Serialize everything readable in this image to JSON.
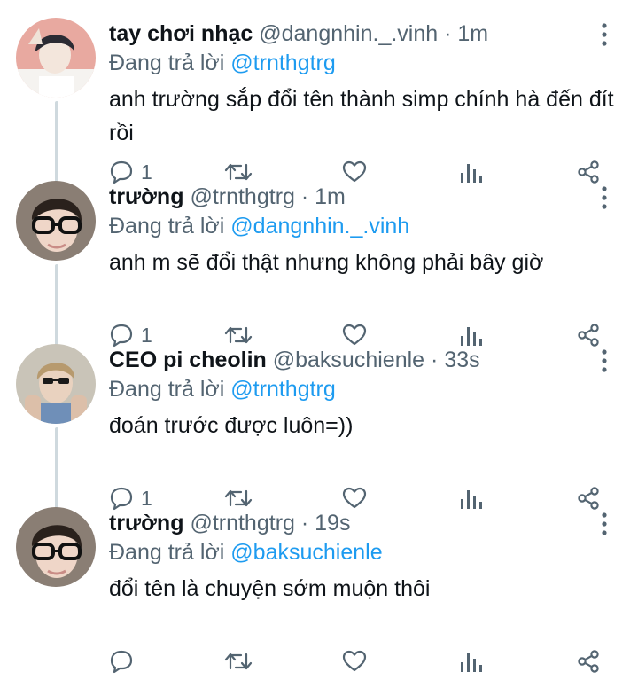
{
  "tweets": [
    {
      "display_name": "tay chơi nhạc",
      "handle": "@dangnhin._.vinh",
      "separator": "·",
      "time": "1m",
      "replying_prefix": "Đang trả lời",
      "replying_to": "@trnthgtrg",
      "text": "anh trường sắp đổi tên thành simp chính hà đến đít rồi",
      "reply_count": "1",
      "avatar_colors": {
        "bg": "#e8a9a0",
        "face": "#f3e6dc",
        "hair": "#2b2b33"
      }
    },
    {
      "display_name": "trường",
      "handle": "@trnthgtrg",
      "separator": "·",
      "time": "1m",
      "replying_prefix": "Đang trả lời",
      "replying_to": "@dangnhin._.vinh",
      "text": "anh m sẽ đổi thật nhưng không phải bây giờ",
      "reply_count": "1",
      "avatar_colors": {
        "bg": "#8a7e74",
        "face": "#efd6c8",
        "hair": "#2a211c"
      }
    },
    {
      "display_name": "CEO pi cheolin",
      "handle": "@baksuchienle",
      "separator": "·",
      "time": "33s",
      "replying_prefix": "Đang trả lời",
      "replying_to": "@trnthgtrg",
      "text": "đoán trước được luôn=))",
      "reply_count": "1",
      "avatar_colors": {
        "bg": "#c9c4b8",
        "face": "#e9d2bf",
        "hair": "#b79a6e"
      }
    },
    {
      "display_name": "trường",
      "handle": "@trnthgtrg",
      "separator": "·",
      "time": "19s",
      "replying_prefix": "Đang trả lời",
      "replying_to": "@baksuchienle",
      "text": "đổi tên là chuyện sớm muộn thôi",
      "reply_count": "",
      "avatar_colors": {
        "bg": "#8a7e74",
        "face": "#efd6c8",
        "hair": "#2a211c"
      }
    }
  ],
  "icons": {
    "reply": "reply-icon",
    "retweet": "retweet-icon",
    "like": "heart-icon",
    "views": "bar-chart-icon",
    "share": "share-icon",
    "more": "more-vertical-icon"
  },
  "colors": {
    "text": "#0f1419",
    "secondary": "#536471",
    "mention": "#1d9bf0",
    "thread_line": "#cfd9de"
  }
}
